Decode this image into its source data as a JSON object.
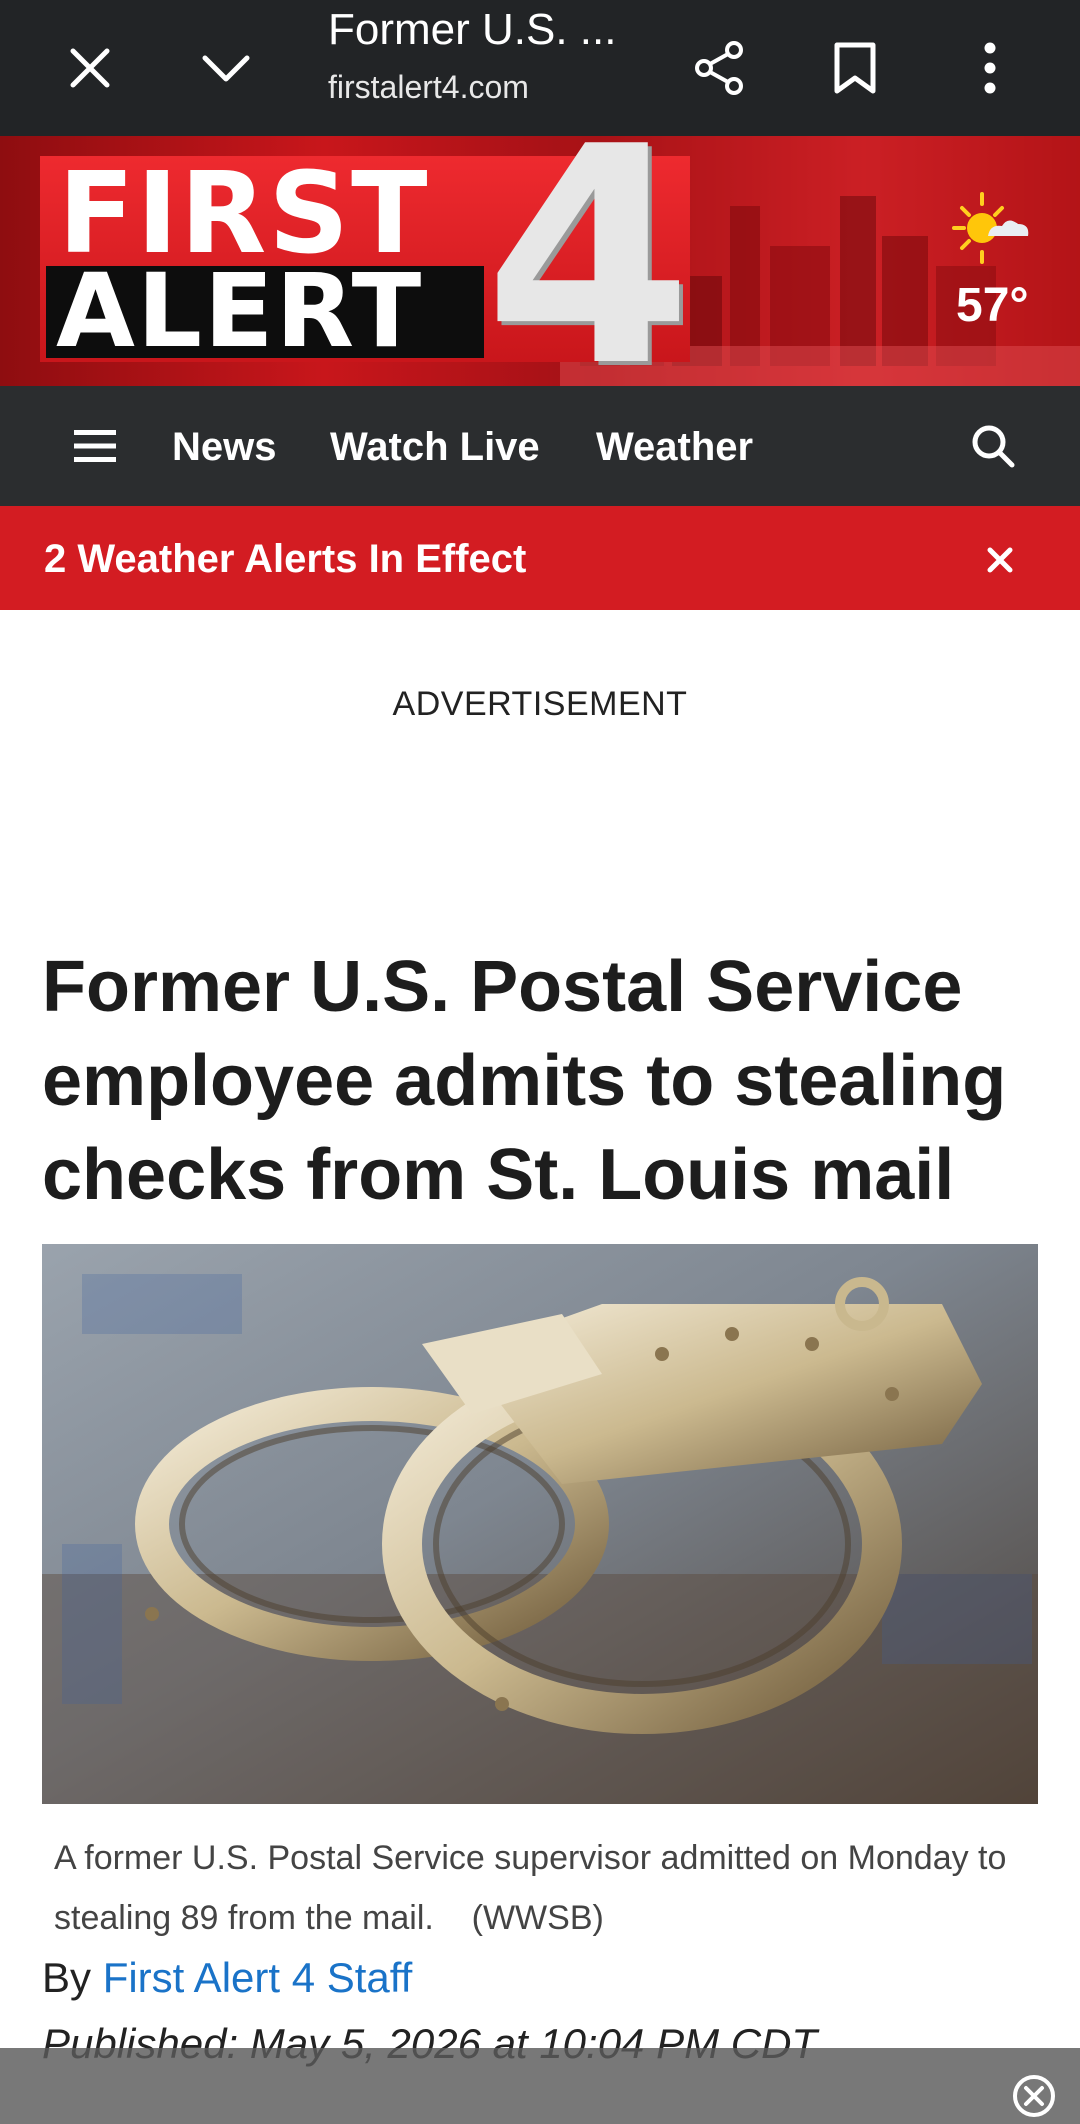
{
  "browser": {
    "title": "Former U.S. ...",
    "url": "firstalert4.com",
    "icons": [
      "close-icon",
      "chevron-down-icon",
      "share-icon",
      "bookmark-icon",
      "more-vert-icon"
    ]
  },
  "banner": {
    "logo_first": "FIRST",
    "logo_alert": "ALERT",
    "logo_number": "4",
    "weather_icon": "partly-sunny-icon",
    "temperature": "57°"
  },
  "nav": {
    "items": [
      {
        "label": "News"
      },
      {
        "label": "Watch Live"
      },
      {
        "label": "Weather"
      }
    ],
    "icons": [
      "menu-icon",
      "search-icon"
    ]
  },
  "alert": {
    "text": "2 Weather Alerts In Effect"
  },
  "ad": {
    "label": "ADVERTISEMENT"
  },
  "article": {
    "headline": "Former U.S. Postal Service employee admits to stealing checks from St. Louis mail",
    "caption": "A former U.S. Postal Service supervisor admitted on Monday to stealing 89 from the mail.",
    "credit": "(WWSB)",
    "byline_prefix": "By",
    "author": "First Alert 4 Staff",
    "published": "Published: May 5, 2026 at 10:04 PM CDT"
  },
  "colors": {
    "toolbar": "#222426",
    "brand_red": "#d31c22",
    "nav_bg": "#2b2d2f",
    "link": "#1a73c8"
  }
}
